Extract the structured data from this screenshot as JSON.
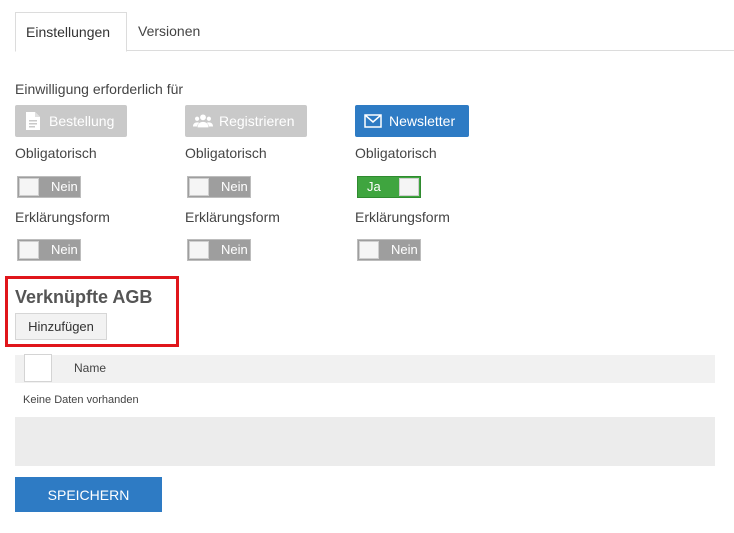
{
  "tabs": [
    {
      "label": "Einstellungen",
      "active": true
    },
    {
      "label": "Versionen",
      "active": false
    }
  ],
  "consent_label": "Einwilligung erforderlich für",
  "columns": [
    {
      "button": {
        "label": "Bestellung",
        "icon": "document-icon",
        "color": "#c9c9c9"
      },
      "obligatory_label": "Obligatorisch",
      "obligatory_toggle": "Nein",
      "declaration_label": "Erklärungsform",
      "declaration_toggle": "Nein"
    },
    {
      "button": {
        "label": "Registrieren",
        "icon": "users-icon",
        "color": "#c9c9c9"
      },
      "obligatory_label": "Obligatorisch",
      "obligatory_toggle": "Nein",
      "declaration_label": "Erklärungsform",
      "declaration_toggle": "Nein"
    },
    {
      "button": {
        "label": "Newsletter",
        "icon": "envelope-icon",
        "color": "#2e7bc4"
      },
      "obligatory_label": "Obligatorisch",
      "obligatory_toggle": "Ja",
      "declaration_label": "Erklärungsform",
      "declaration_toggle": "Nein"
    }
  ],
  "agb": {
    "title": "Verknüpfte AGB",
    "add_label": "Hinzufügen",
    "table": {
      "header_name": "Name",
      "empty_text": "Keine Daten vorhanden"
    }
  },
  "save_label": "SPEICHERN",
  "colors": {
    "accent": "#2e7bc4",
    "toggle_on": "#3fa53f",
    "highlight": "#e0161b"
  }
}
